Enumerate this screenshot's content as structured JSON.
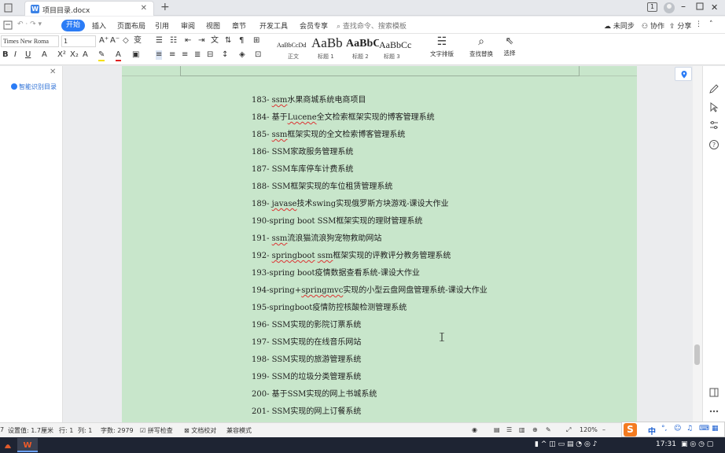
{
  "titlebar": {
    "doc_tab_title": "项目目录.docx",
    "doc_icon_letter": "W"
  },
  "menu": {
    "items": [
      "三",
      "开始",
      "插入",
      "页面布局",
      "引用",
      "审阅",
      "视图",
      "章节",
      "开发工具",
      "会员专享"
    ],
    "active_label": "开始",
    "search_placeholder": "查找命令、搜索模板",
    "right": {
      "sync": "未同步",
      "collab": "协作",
      "share": "分享"
    }
  },
  "ribbon": {
    "font_name": "Times New Roma",
    "font_size": "1",
    "styles": [
      {
        "sample": "AaBbCcDd",
        "label": "正文"
      },
      {
        "sample": "AaBb",
        "label": "标题 1"
      },
      {
        "sample": "AaBbC",
        "label": "标题 2"
      },
      {
        "sample": "AaBbCc",
        "label": "标题 3"
      }
    ],
    "tools": {
      "text_layout": "文字排版",
      "find_replace": "查找替换",
      "select": "选择"
    }
  },
  "left_pane": {
    "smart_toc": "智能识别目录"
  },
  "document": {
    "lines": [
      {
        "num": "183",
        "sep": "- ",
        "parts": [
          {
            "t": "ssm",
            "u": true
          },
          {
            "t": "水果商城系统电商项目"
          }
        ]
      },
      {
        "num": "184",
        "sep": "- ",
        "parts": [
          {
            "t": "基于"
          },
          {
            "t": "Lucene",
            "u": true
          },
          {
            "t": "全文检索框架实现的博客管理系统"
          }
        ]
      },
      {
        "num": "185",
        "sep": "- ",
        "parts": [
          {
            "t": "ssm",
            "u": true
          },
          {
            "t": "框架实现的全文检索博客管理系统"
          }
        ]
      },
      {
        "num": "186",
        "sep": "- ",
        "parts": [
          {
            "t": "SSM家政服务管理系统"
          }
        ]
      },
      {
        "num": "187",
        "sep": "- ",
        "parts": [
          {
            "t": "SSM车库停车计费系统"
          }
        ]
      },
      {
        "num": "188",
        "sep": "- ",
        "parts": [
          {
            "t": "SSM框架实现的车位租赁管理系统"
          }
        ]
      },
      {
        "num": "189",
        "sep": "- ",
        "parts": [
          {
            "t": "javase",
            "u": true
          },
          {
            "t": "技术swing实现俄罗斯方块游戏-课设大作业"
          }
        ]
      },
      {
        "num": "190",
        "sep": "-",
        "parts": [
          {
            "t": "spring boot SSM框架实现的理财管理系统"
          }
        ]
      },
      {
        "num": "191",
        "sep": "- ",
        "parts": [
          {
            "t": "ssm",
            "u": true
          },
          {
            "t": "流浪猫流浪狗宠物救助网站"
          }
        ]
      },
      {
        "num": "192",
        "sep": "- ",
        "parts": [
          {
            "t": "springboot",
            "u": true
          },
          {
            "t": " "
          },
          {
            "t": "ssm",
            "u": true
          },
          {
            "t": "框架实现的评教评分教务管理系统"
          }
        ]
      },
      {
        "num": "193",
        "sep": "-",
        "parts": [
          {
            "t": "spring boot疫情数据查看系统-课设大作业"
          }
        ]
      },
      {
        "num": "194",
        "sep": "-",
        "parts": [
          {
            "t": "spring+"
          },
          {
            "t": "springmvc",
            "u": true
          },
          {
            "t": "实现的小型云盘网盘管理系统-课设大作业"
          }
        ]
      },
      {
        "num": "195",
        "sep": "-",
        "parts": [
          {
            "t": "springboot疫情防控核酸检测管理系统"
          }
        ]
      },
      {
        "num": "196",
        "sep": "- ",
        "parts": [
          {
            "t": "SSM实现的影院订票系统"
          }
        ]
      },
      {
        "num": "197",
        "sep": "- ",
        "parts": [
          {
            "t": "SSM实现的在线音乐网站"
          }
        ]
      },
      {
        "num": "198",
        "sep": "- ",
        "parts": [
          {
            "t": "SSM实现的旅游管理系统"
          }
        ]
      },
      {
        "num": "199",
        "sep": "- ",
        "parts": [
          {
            "t": "SSM的垃圾分类管理系统"
          }
        ]
      },
      {
        "num": "200",
        "sep": "- ",
        "parts": [
          {
            "t": "基于SSM实现的网上书城系统"
          }
        ]
      },
      {
        "num": "201",
        "sep": "- ",
        "parts": [
          {
            "t": "SSM实现的网上订餐系统"
          }
        ]
      }
    ]
  },
  "statusbar": {
    "position": "设置值: 1.7厘米",
    "row": "行: 1",
    "col": "列: 1",
    "wordcount": "字数: 2979",
    "spellcheck": "拼写检查",
    "proofread": "文档校对",
    "protect_mode": "兼容模式",
    "zoom": "120%"
  },
  "taskbar": {
    "clock": "17:31",
    "ime_lang": "中"
  },
  "colors": {
    "accent": "#2b7cf6",
    "page_bg": "#c8e6cb",
    "ime_brand": "#f47b20",
    "taskbar": "#1e2433"
  }
}
